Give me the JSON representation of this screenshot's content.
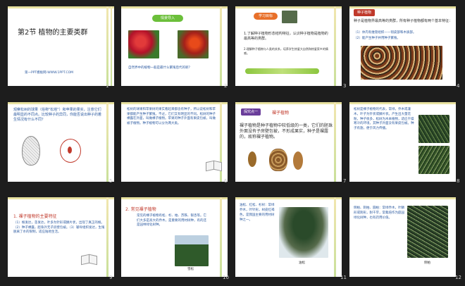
{
  "slides": [
    {
      "num": "1",
      "title": "第2节  植物的主要类群",
      "footer": "第一PPT模板网-WWW.1PPT.COM"
    },
    {
      "num": "2",
      "badge": "情景导入",
      "question": "自然界中的植物一般是最什么繁殖后代的呢？"
    },
    {
      "num": "3",
      "badge": "学习目标",
      "goal1": "1.了解种子植物形态结构特征，认识种子植物是植物的最高等的类群。",
      "goal2": "2.理解种子植物与人类的关系，培养学生热爱大自然和热爱家乡的情感。"
    },
    {
      "num": "4",
      "heading": "种子植物",
      "body": "种子是植物界最高等的类群，所有种子植物都有两个基本特征：",
      "point1": "（1）体内有维管组织——韧皮部和木质部。",
      "point2": "（2）能产生种子并用种子繁殖。"
    },
    {
      "num": "5",
      "body": "观察松树的球果（俗称\"松塔\"）和苹果的果实，注意它们最明显的不同点。比较种子的异同，你能否说出种子的着生情况有什么不同？"
    },
    {
      "num": "6",
      "body": "松树的球果和苹果树的果实看起来都含有种子，所以说松树和苹果都能产生种子繁殖。不过，它们又有明显的不同。松树的种子裸露在外面，叫做裸子植物。苹果的种子外面有果皮包被，叫做被子植物。种子植物可以分为两大类。"
    },
    {
      "num": "7",
      "badge": "探究点一",
      "heading": "裸子植物",
      "body": "裸子植物是种子植物中较低级的一类，它们的胚珠外面没有子房壁包被，不形成果实，种子是裸露的，故称裸子植物。"
    },
    {
      "num": "8",
      "body": "松树是裸子植物的代表，常绿，乔木或灌木，叶子为针状或鳞片状。产生出大量花粉，种子很多，松树为木本植物，适应干燥寒冷的环境，其种子外面没有果皮包被。种子有翅，便于风力传播。"
    },
    {
      "num": "9",
      "heading": "1. 裸子植物的主要特征",
      "body": "（1）根发达，茎发达，叶多为针形或鳞片状，出现了真正的根。（2）种子裸露，胚珠外无子房壁包被。（3）输导组织发达，生殖脱离了水的限制，适应陆地生活。"
    },
    {
      "num": "10",
      "heading": "2. 常见裸子植物",
      "body": "常见的裸子植物有松、杉、柏、苏铁、银杏等。它们大多是高大的乔木，是重要的用材树种，有的还是园林绿化树种。",
      "caption": "雪松"
    },
    {
      "num": "11",
      "body": "油松、红松、杉树：常绿乔木，叶针形，树皮红褐色，是我国主要的用材树种之一。",
      "caption": "油松"
    },
    {
      "num": "12",
      "body": "侧柏、刺柏、圆柏：常绿乔木，叶鳞形或刺形，耐干旱，常栽培作为庭园绿化树种，也有药用价值。",
      "caption": "侧柏"
    }
  ]
}
